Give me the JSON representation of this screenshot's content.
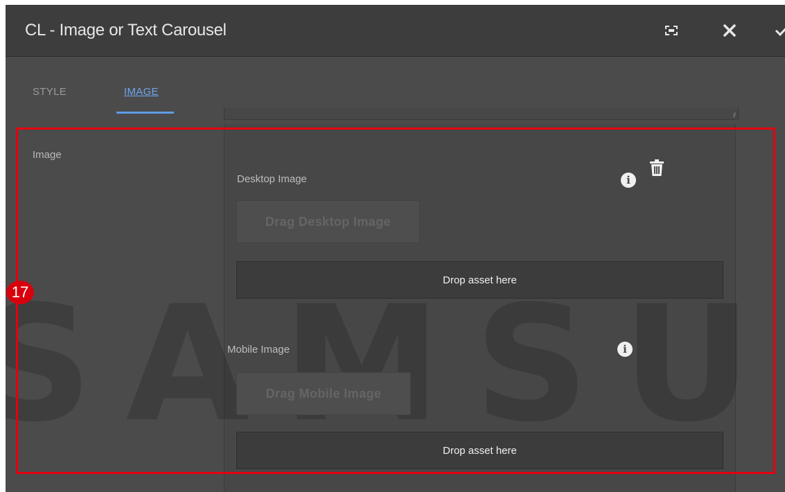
{
  "dialog": {
    "title": "CL - Image or Text Carousel"
  },
  "tabs": [
    {
      "label": "STYLE",
      "active": false
    },
    {
      "label": "IMAGE",
      "active": true
    }
  ],
  "section": {
    "label": "Image"
  },
  "desktop": {
    "label": "Desktop Image",
    "drag_label": "Drag Desktop Image",
    "drop_label": "Drop asset here"
  },
  "mobile": {
    "label": "Mobile Image",
    "drag_label": "Drag Mobile Image",
    "drop_label": "Drop asset here"
  },
  "annotation": {
    "step": "17",
    "color": "#e6000f"
  },
  "watermark": "SAMSUNG",
  "colors": {
    "accent": "#5f9be8",
    "panel": "#4b4b4b",
    "titlebar": "#3d3d3d"
  },
  "icons": {
    "fullscreen": "fullscreen-icon",
    "close": "close-icon",
    "done": "checkmark-icon",
    "info": "info-icon",
    "delete": "trash-icon"
  }
}
